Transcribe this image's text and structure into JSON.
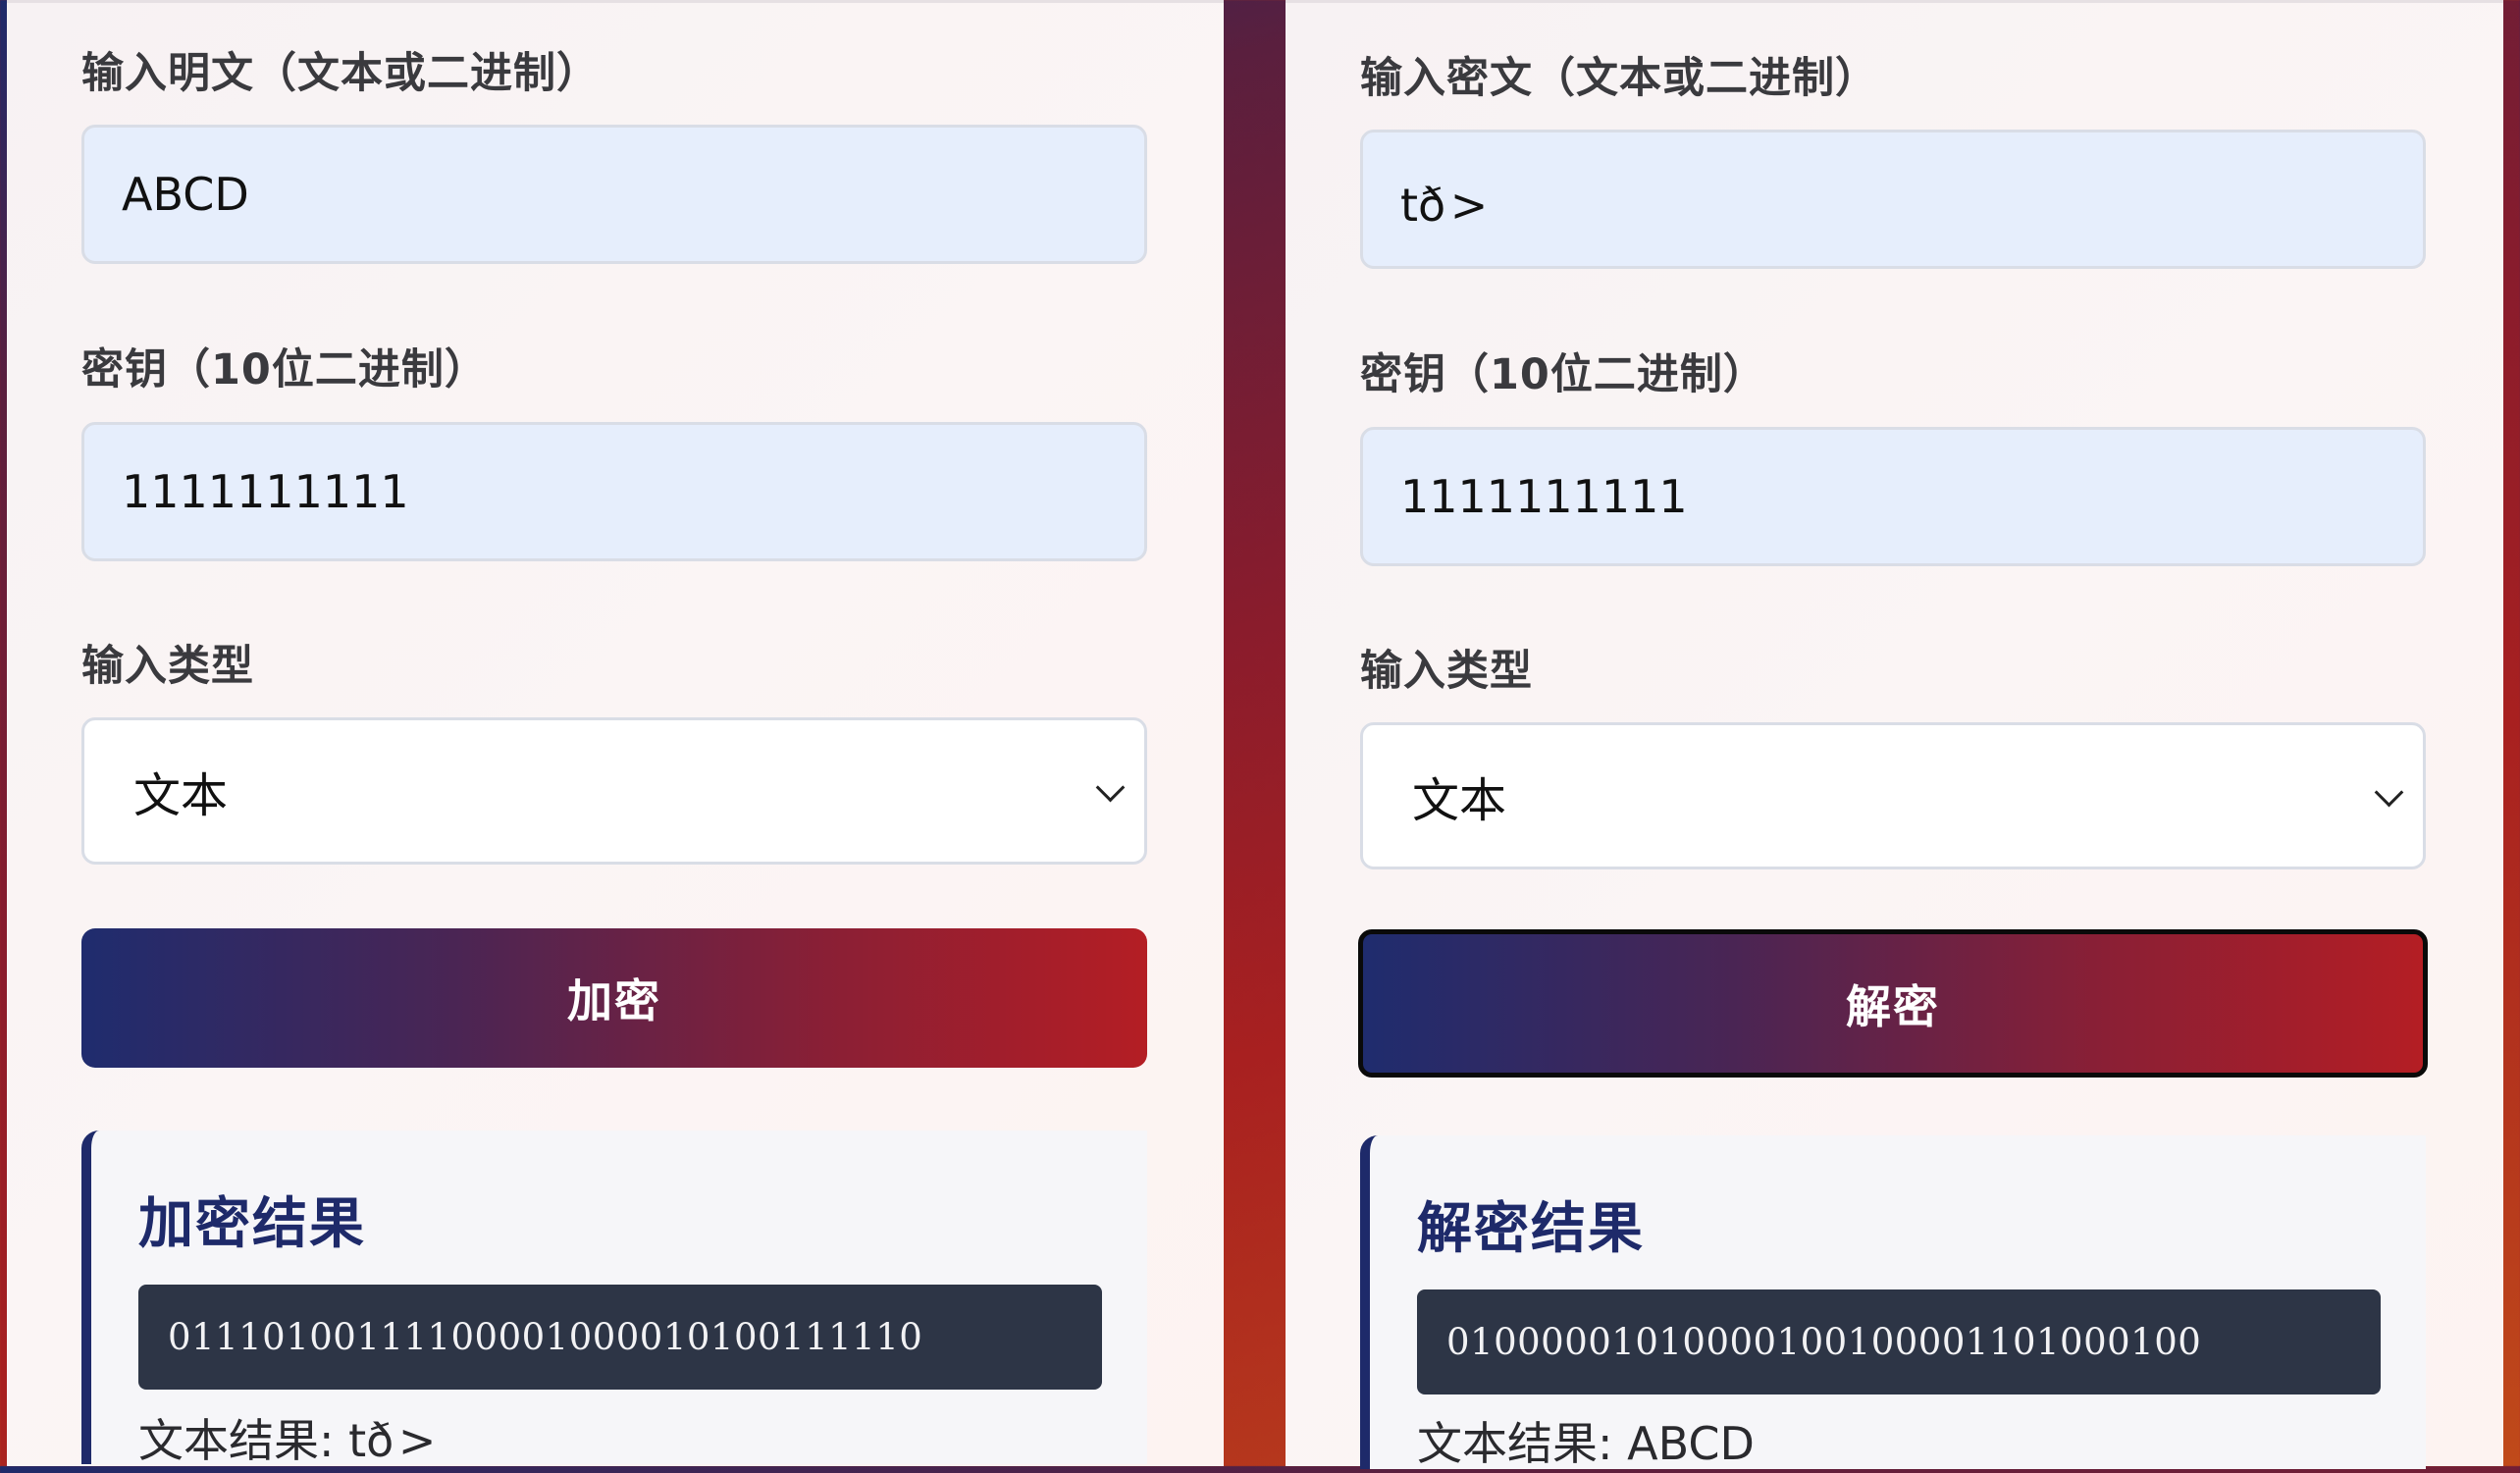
{
  "encrypt": {
    "plaintext_label": "输入明文（文本或二进制）",
    "plaintext_value": "ABCD",
    "key_label": "密钥（10位二进制）",
    "key_value": "1111111111",
    "type_label": "输入类型",
    "type_value": "文本",
    "button_label": "加密",
    "result_title": "加密结果",
    "result_binary": "01110100111100001000010100111110",
    "result_text": "文本结果: tð>"
  },
  "decrypt": {
    "ciphertext_label": "输入密文（文本或二进制）",
    "ciphertext_value": "tð>",
    "key_label": "密钥（10位二进制）",
    "key_value": "1111111111",
    "type_label": "输入类型",
    "type_value": "文本",
    "button_label": "解密",
    "result_title": "解密结果",
    "result_binary": "01000001010000100100001101000100",
    "result_text": "文本结果: ABCD"
  }
}
